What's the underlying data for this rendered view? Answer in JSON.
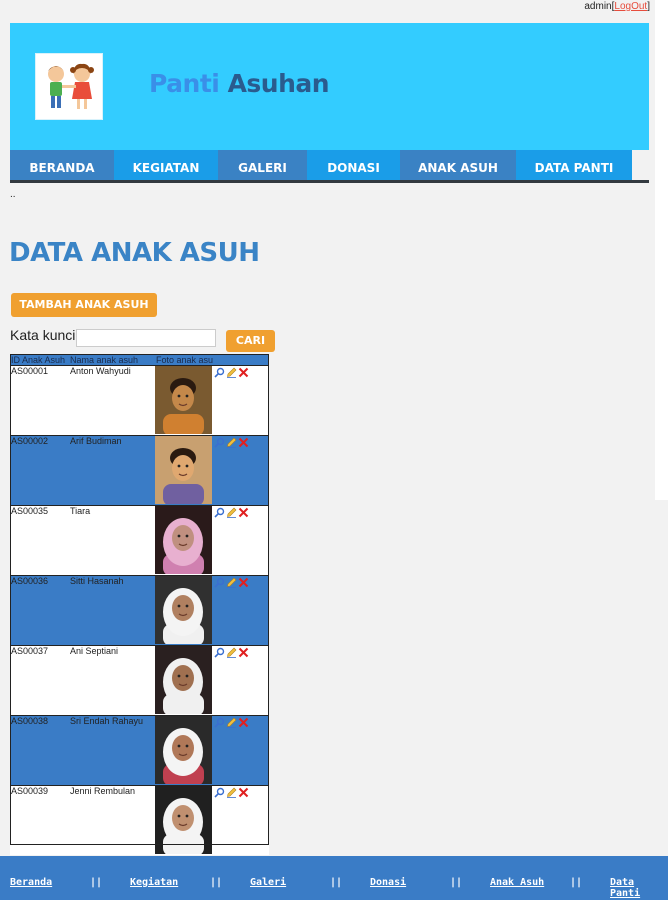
{
  "topbar": {
    "user": "admin",
    "bracket_open": "[",
    "logout_label": "LogOut",
    "bracket_close": "]"
  },
  "site": {
    "title_part1": "Panti",
    "title_part2": "Asuhan"
  },
  "nav": {
    "items": [
      "BERANDA",
      "KEGIATAN",
      "GALERI",
      "DONASI",
      "ANAK ASUH",
      "DATA PANTI"
    ]
  },
  "breadcrumb": "..",
  "page": {
    "title": "DATA ANAK ASUH",
    "add_button": "TAMBAH ANAK ASUH",
    "search_label": "Kata kunci:",
    "search_value": "",
    "search_button": "CARI"
  },
  "table": {
    "headers": [
      "ID Anak Asuh",
      "Nama anak asuh",
      "Foto anak asuh",
      ""
    ],
    "rows": [
      {
        "id": "AS00001",
        "name": "Anton Wahyudi"
      },
      {
        "id": "AS00002",
        "name": "Arif Budiman"
      },
      {
        "id": "AS00035",
        "name": "Tiara"
      },
      {
        "id": "AS00036",
        "name": "Sitti Hasanah"
      },
      {
        "id": "AS00037",
        "name": "Ani Septiani"
      },
      {
        "id": "AS00038",
        "name": "Sri Endah Rahayu"
      },
      {
        "id": "AS00039",
        "name": "Jenni Rembulan"
      }
    ],
    "row_actions": [
      "view-icon",
      "edit-icon",
      "delete-icon"
    ]
  },
  "footer": {
    "links": [
      "Beranda",
      "Kegiatan",
      "Galeri",
      "Donasi",
      "Anak Asuh",
      "Data Panti"
    ],
    "separator": "||"
  },
  "colors": {
    "header_bg": "#33ccff",
    "nav_dark": "#3a82c4",
    "nav_light": "#1a9de8",
    "accent_orange": "#f0a030",
    "row_blue": "#3a7cc6",
    "title_blue": "#3a84c6"
  }
}
